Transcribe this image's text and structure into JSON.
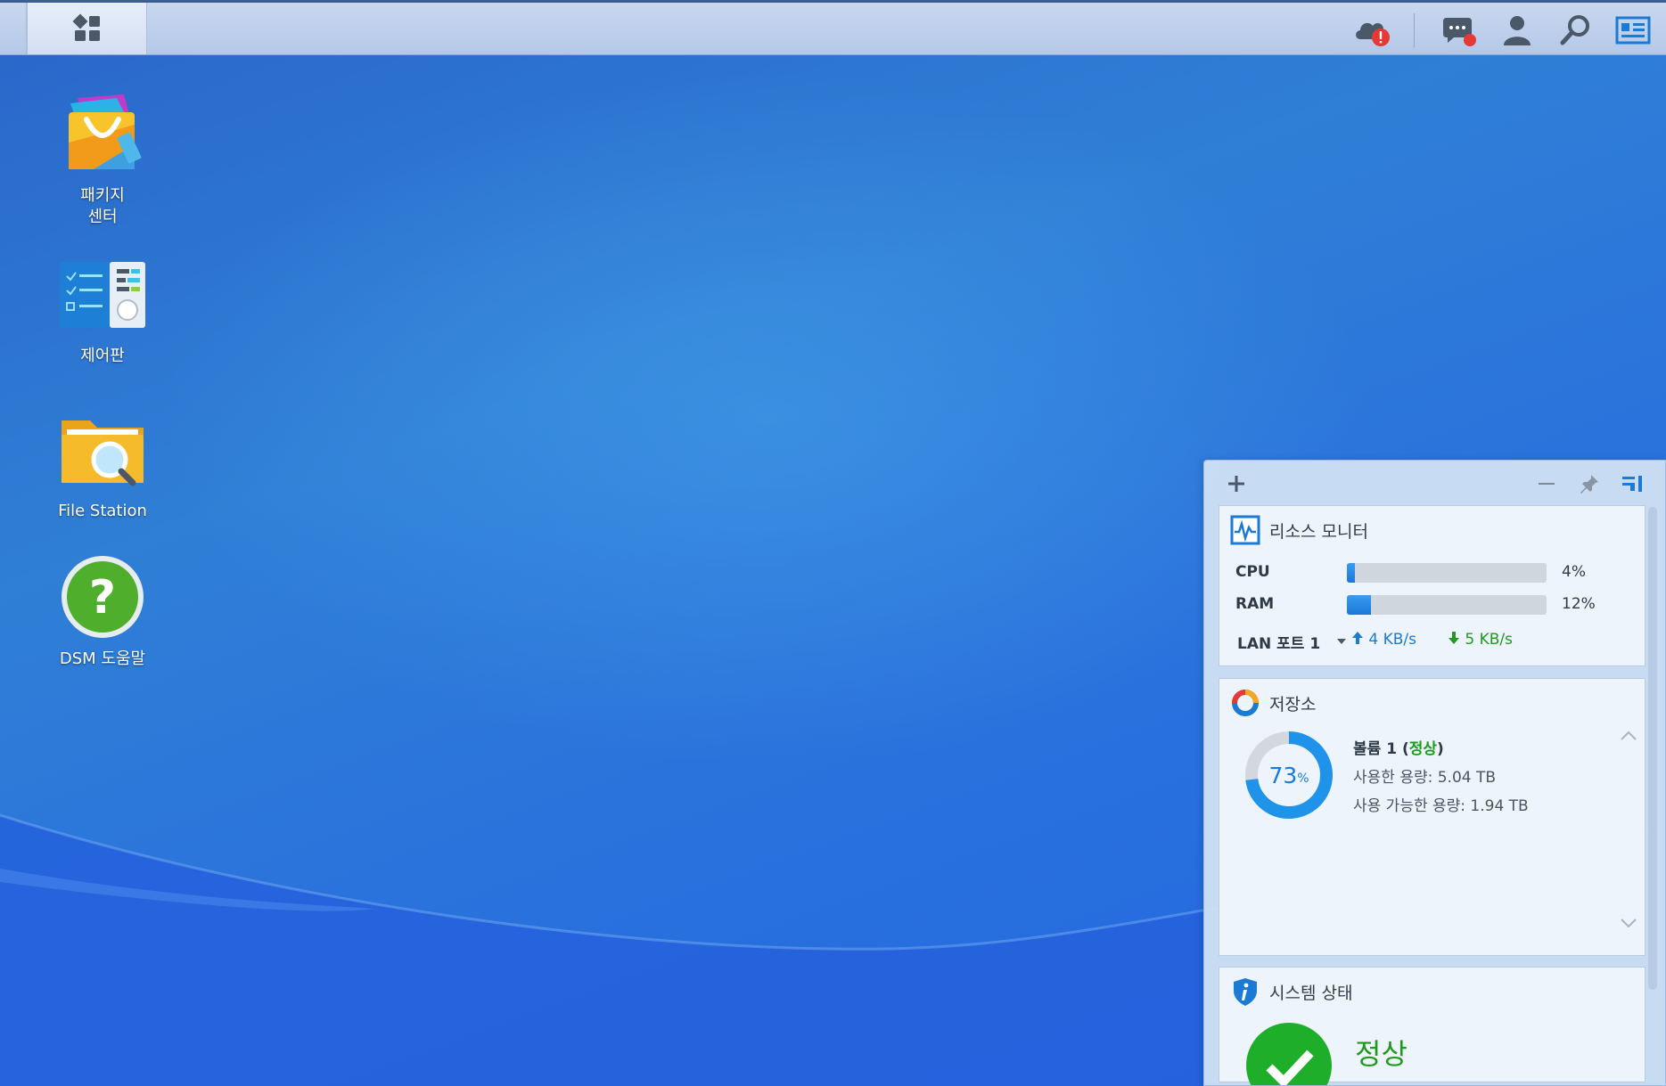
{
  "taskbar": {
    "main_menu_icon": "grid-icon",
    "icons": [
      "cloud-alert-icon",
      "chat-icon",
      "user-icon",
      "search-icon",
      "widgets-icon"
    ]
  },
  "desktop": {
    "icons": [
      {
        "name": "package-center",
        "label": "패키지\n센터"
      },
      {
        "name": "control-panel",
        "label": "제어판"
      },
      {
        "name": "file-station",
        "label": "File Station"
      },
      {
        "name": "dsm-help",
        "label": "DSM 도움말"
      }
    ]
  },
  "widget_panel": {
    "resource_monitor": {
      "title": "리소스 모니터",
      "cpu_label": "CPU",
      "cpu_value": "4%",
      "cpu_fraction": 0.04,
      "ram_label": "RAM",
      "ram_value": "12%",
      "ram_fraction": 0.12,
      "lan_label": "LAN 포트 1",
      "upload": "4 KB/s",
      "download": "5 KB/s"
    },
    "storage": {
      "title": "저장소",
      "percent": "73",
      "percent_unit": "%",
      "used_fraction": 0.73,
      "volume_name": "볼륨 1 (",
      "volume_status": "정상",
      "volume_close": ")",
      "used_label": "사용한 용량: 5.04 TB",
      "available_label": "사용 가능한 용량: 1.94 TB"
    },
    "system_status": {
      "title": "시스템 상태",
      "status": "정상"
    }
  },
  "colors": {
    "accent_blue": "#1b7ad4",
    "ok_green": "#1f9a1f",
    "alert_red": "#e53935"
  }
}
